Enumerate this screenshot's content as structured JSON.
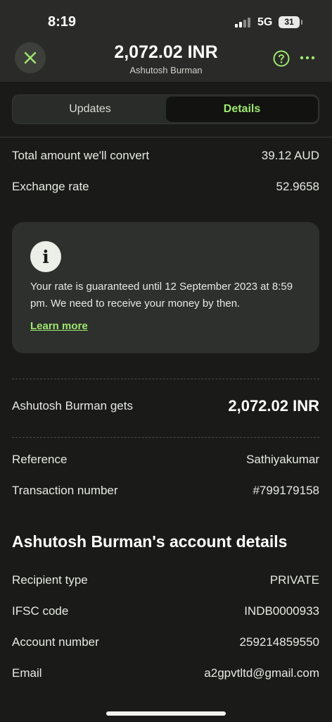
{
  "status_bar": {
    "time": "8:19",
    "network": "5G",
    "battery": "31"
  },
  "header": {
    "title": "2,072.02 INR",
    "subtitle": "Ashutosh Burman",
    "accent_color": "#9fe870"
  },
  "tabs": [
    {
      "label": "Updates",
      "selected": false
    },
    {
      "label": "Details",
      "selected": true
    }
  ],
  "conversion": {
    "total_label": "Total amount we'll convert",
    "total_value": "39.12 AUD",
    "rate_label": "Exchange rate",
    "rate_value": "52.9658"
  },
  "info_card": {
    "icon": "info-icon",
    "text": "Your rate is guaranteed until 12 September 2023 at 8:59 pm. We need to receive your money by then.",
    "link": "Learn more"
  },
  "recipient_gets": {
    "label": "Ashutosh Burman gets",
    "value": "2,072.02 INR"
  },
  "transfer": {
    "reference_label": "Reference",
    "reference_value": "Sathiyakumar",
    "txn_label": "Transaction number",
    "txn_value": "#799179158"
  },
  "account": {
    "title": "Ashutosh Burman's account details",
    "rows": [
      {
        "label": "Recipient type",
        "value": "PRIVATE"
      },
      {
        "label": "IFSC code",
        "value": "INDB0000933"
      },
      {
        "label": "Account number",
        "value": "259214859550"
      },
      {
        "label": "Email",
        "value": "a2gpvtltd@gmail.com"
      }
    ]
  }
}
